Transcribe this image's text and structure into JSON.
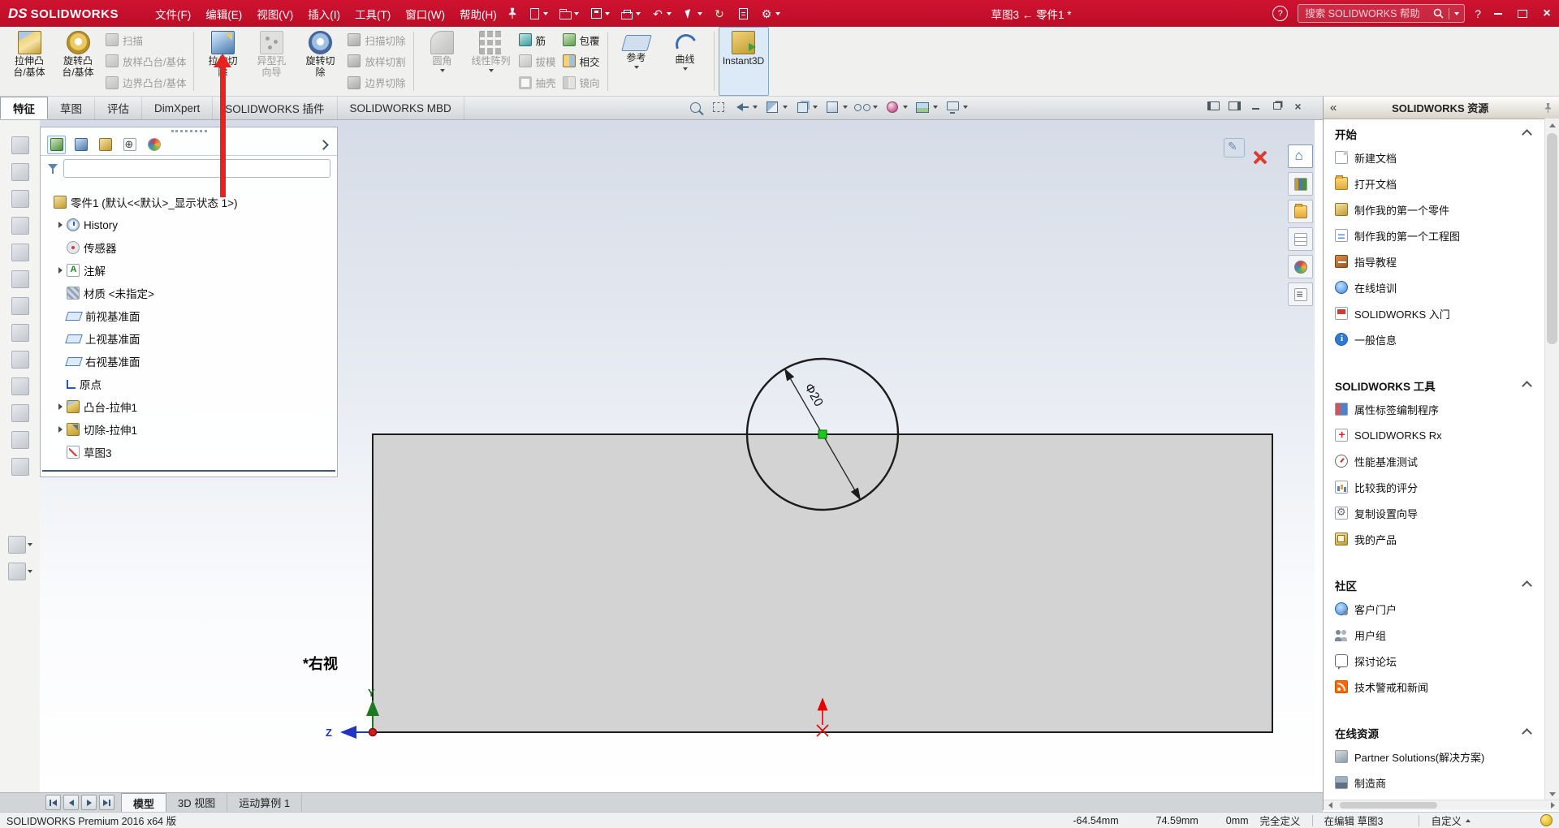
{
  "titlebar": {
    "logo_ds": "DS",
    "logo_text": "SOLIDWORKS",
    "menus": [
      "文件(F)",
      "编辑(E)",
      "视图(V)",
      "插入(I)",
      "工具(T)",
      "窗口(W)",
      "帮助(H)"
    ],
    "document_title": "草图3 ← 零件1 *",
    "search_placeholder": "搜索 SOLIDWORKS 帮助",
    "help_label": "?"
  },
  "quick_access": [
    {
      "icon": "new-document-icon",
      "caret": true
    },
    {
      "icon": "open-icon",
      "caret": true
    },
    {
      "icon": "save-icon",
      "caret": true
    },
    {
      "icon": "print-icon",
      "caret": true
    },
    {
      "icon": "undo-icon",
      "caret": true
    },
    {
      "icon": "select-icon",
      "caret": true
    },
    {
      "icon": "rebuild-icon",
      "caret": false
    },
    {
      "icon": "file-properties-icon",
      "caret": false
    },
    {
      "icon": "options-icon",
      "caret": true
    }
  ],
  "ribbon": {
    "extrude_boss": {
      "l1": "拉伸凸",
      "l2": "台/基体"
    },
    "revolve_boss": {
      "l1": "旋转凸",
      "l2": "台/基体"
    },
    "stack1": [
      {
        "icon": "sweep-icon",
        "label": "扫描",
        "disabled": true
      },
      {
        "icon": "loft-icon",
        "label": "放样凸台/基体",
        "disabled": true
      },
      {
        "icon": "boundary-icon",
        "label": "边界凸台/基体",
        "disabled": true
      }
    ],
    "extruded_cut": {
      "l1": "拉伸切",
      "l2": "除"
    },
    "hole_wizard": {
      "l1": "异型孔",
      "l2": "向导"
    },
    "revolved_cut": {
      "l1": "旋转切",
      "l2": "除"
    },
    "stack2": [
      {
        "icon": "swept-cut-icon",
        "label": "扫描切除",
        "disabled": true
      },
      {
        "icon": "lofted-cut-icon",
        "label": "放样切割",
        "disabled": true
      },
      {
        "icon": "boundary-cut-icon",
        "label": "边界切除",
        "disabled": true
      }
    ],
    "fillet": "圆角",
    "linear_pattern": "线性阵列",
    "stack3": [
      {
        "icon": "rib-icon",
        "label": "筋"
      },
      {
        "icon": "draft-icon",
        "label": "拔模",
        "disabled": true
      },
      {
        "icon": "shell-icon",
        "label": "抽壳",
        "disabled": true
      }
    ],
    "stack4": [
      {
        "icon": "wrap-icon",
        "label": "包覆"
      },
      {
        "icon": "intersect-icon",
        "label": "相交"
      },
      {
        "icon": "mirror-icon",
        "label": "镜向",
        "disabled": true
      }
    ],
    "reference": "参考",
    "curves": "曲线",
    "instant3d": "Instant3D"
  },
  "tabs": [
    {
      "label": "特征",
      "active": true
    },
    {
      "label": "草图"
    },
    {
      "label": "评估"
    },
    {
      "label": "DimXpert"
    },
    {
      "label": "SOLIDWORKS 插件"
    },
    {
      "label": "SOLIDWORKS MBD"
    }
  ],
  "hud": [
    {
      "icon": "zoom-fit-icon",
      "caret": false
    },
    {
      "icon": "zoom-area-icon",
      "caret": false
    },
    {
      "icon": "previous-view-icon",
      "caret": true
    },
    {
      "icon": "section-view-icon",
      "caret": true
    },
    {
      "icon": "view-orientation-icon",
      "caret": true
    },
    {
      "icon": "display-style-icon",
      "caret": true
    },
    {
      "icon": "hide-show-icon",
      "caret": true
    },
    {
      "icon": "edit-appearance-icon",
      "caret": true
    },
    {
      "icon": "apply-scene-icon",
      "caret": true
    },
    {
      "icon": "view-settings-icon",
      "caret": true
    }
  ],
  "left_toolbar": [
    "extrude-boss-small-icon",
    "revolve-boss-small-icon",
    "sweep-small-icon",
    "loft-small-icon",
    "boundary-small-icon",
    "extruded-cut-small-icon",
    "hole-wizard-small-icon",
    "revolved-cut-small-icon",
    "swept-cut-small-icon",
    "lofted-cut-small-icon",
    "boundary-cut-small-icon",
    "fillet-small-icon",
    "linear-pattern-small-icon"
  ],
  "left_toolbar_flyouts": [
    "reference-geometry-flyout-icon",
    "curves-flyout-icon"
  ],
  "feature_tree": {
    "items": [
      {
        "icon": "part-icon",
        "label": "零件1 (默认<<默认>_显示状态 1>)",
        "root": true
      },
      {
        "icon": "history-folder-icon",
        "label": "History",
        "expand": true
      },
      {
        "icon": "sensors-icon",
        "label": "传感器"
      },
      {
        "icon": "annotations-icon",
        "label": "注解",
        "expand": true
      },
      {
        "icon": "material-icon",
        "label": "材质 <未指定>"
      },
      {
        "icon": "plane-icon",
        "label": "前视基准面"
      },
      {
        "icon": "plane-icon",
        "label": "上视基准面"
      },
      {
        "icon": "plane-icon",
        "label": "右视基准面"
      },
      {
        "icon": "origin-icon",
        "label": "原点"
      },
      {
        "icon": "boss-extrude-icon",
        "label": "凸台-拉伸1",
        "expand": true
      },
      {
        "icon": "cut-extrude-icon",
        "label": "切除-拉伸1",
        "expand": true
      },
      {
        "icon": "sketch-icon",
        "label": "草图3"
      }
    ]
  },
  "viewport": {
    "view_label": "*右视",
    "dimension_label": "Φ20",
    "axis_y": "Y",
    "axis_z": "Z"
  },
  "task_tabs": [
    {
      "icon": "home-icon",
      "active": true
    },
    {
      "icon": "design-library-icon"
    },
    {
      "icon": "file-explorer-icon"
    },
    {
      "icon": "view-palette-icon"
    },
    {
      "icon": "appearances-icon"
    },
    {
      "icon": "custom-properties-icon"
    }
  ],
  "resources": {
    "title": "SOLIDWORKS 资源",
    "sections": [
      {
        "title": "开始",
        "items": [
          {
            "icon": "res-new-document-icon",
            "label": "新建文档"
          },
          {
            "icon": "res-open-document-icon",
            "label": "打开文档"
          },
          {
            "icon": "first-part-icon",
            "label": "制作我的第一个零件"
          },
          {
            "icon": "first-drawing-icon",
            "label": "制作我的第一个工程图"
          },
          {
            "icon": "tutorials-icon",
            "label": "指导教程"
          },
          {
            "icon": "online-training-icon",
            "label": "在线培训"
          },
          {
            "icon": "getting-started-icon",
            "label": "SOLIDWORKS 入门"
          },
          {
            "icon": "general-info-icon",
            "label": "一般信息"
          }
        ]
      },
      {
        "title": "SOLIDWORKS 工具",
        "items": [
          {
            "icon": "property-tab-builder-icon",
            "label": "属性标签编制程序"
          },
          {
            "icon": "solidworks-rx-icon",
            "label": "SOLIDWORKS Rx"
          },
          {
            "icon": "performance-benchmark-icon",
            "label": "性能基准测试"
          },
          {
            "icon": "compare-scores-icon",
            "label": "比较我的评分"
          },
          {
            "icon": "copy-settings-icon",
            "label": "复制设置向导"
          },
          {
            "icon": "my-products-icon",
            "label": "我的产品"
          }
        ]
      },
      {
        "title": "社区",
        "items": [
          {
            "icon": "customer-portal-icon",
            "label": "客户门户"
          },
          {
            "icon": "user-groups-icon",
            "label": "用户组"
          },
          {
            "icon": "discussion-forum-icon",
            "label": "探讨论坛"
          },
          {
            "icon": "tech-alerts-icon",
            "label": "技术警戒和新闻"
          }
        ]
      },
      {
        "title": "在线资源",
        "items": [
          {
            "icon": "partner-solutions-icon",
            "label": "Partner Solutions(解决方案)"
          },
          {
            "icon": "manufacturers-icon",
            "label": "制造商"
          }
        ]
      }
    ]
  },
  "bottom": {
    "tabs": [
      {
        "label": "模型",
        "active": true
      },
      {
        "label": "3D 视图"
      },
      {
        "label": "运动算例 1"
      }
    ]
  },
  "status": {
    "product": "SOLIDWORKS Premium 2016 x64 版",
    "x": "-64.54mm",
    "y": "74.59mm",
    "z": "0mm",
    "state": "完全定义",
    "editing": "在编辑 草图3",
    "custom": "自定义"
  }
}
